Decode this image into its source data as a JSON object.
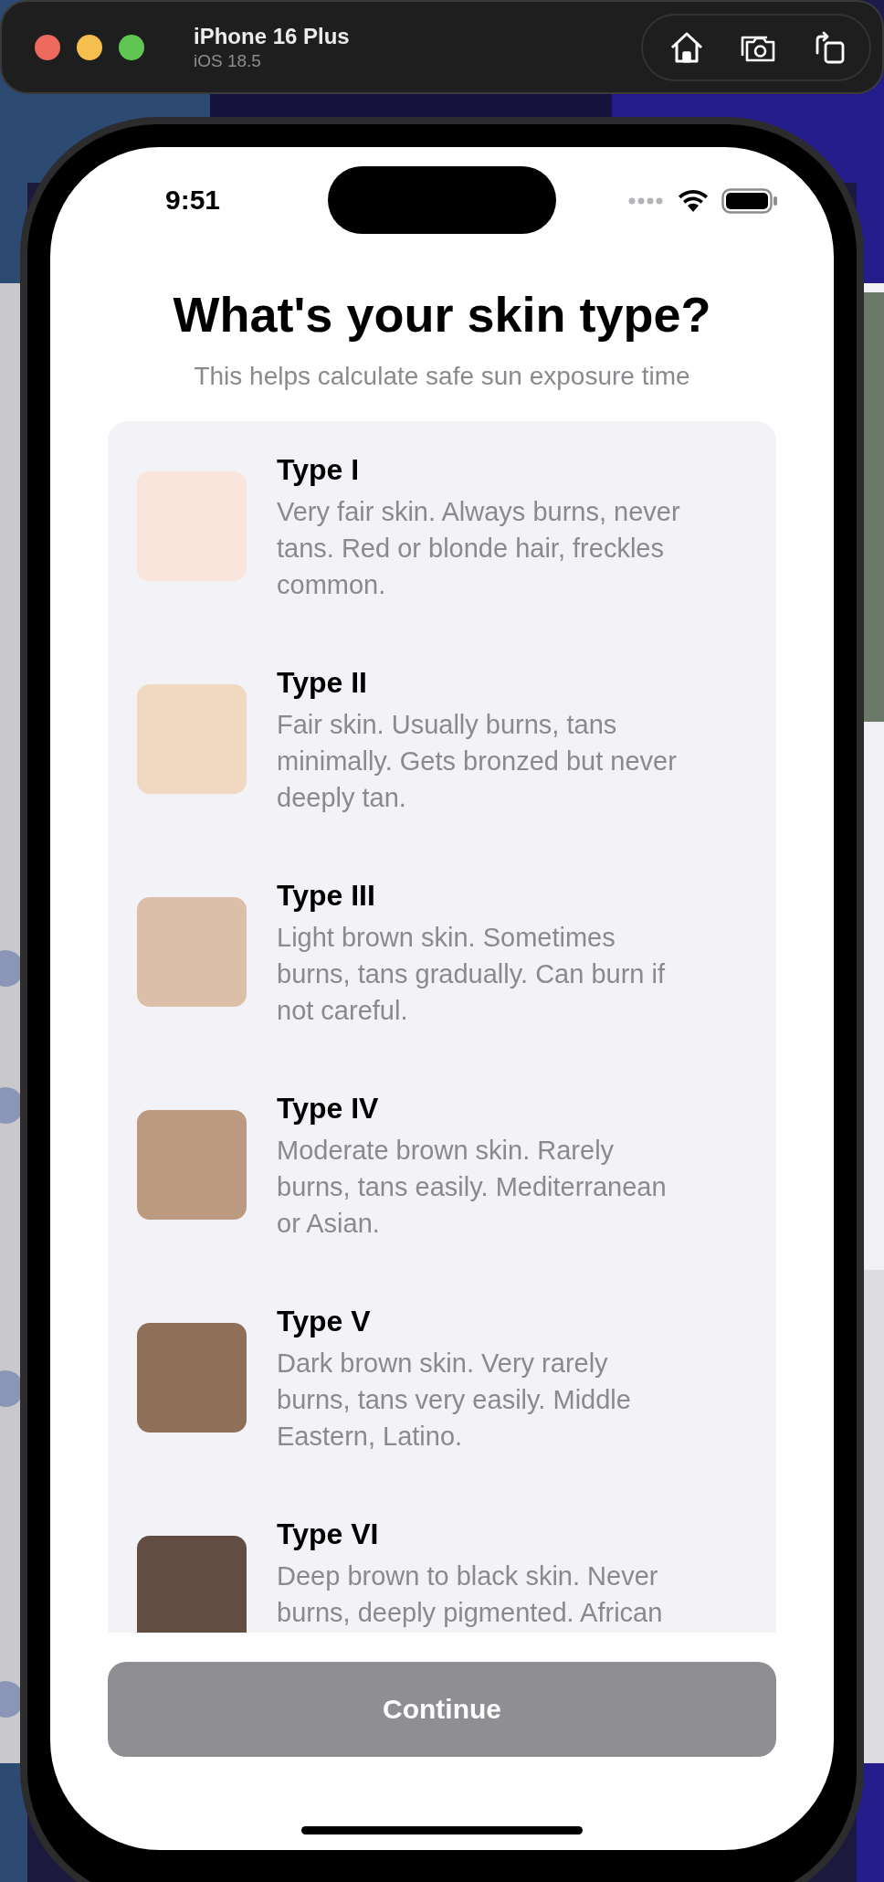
{
  "simulator": {
    "device": "iPhone 16 Plus",
    "os": "iOS 18.5"
  },
  "status_bar": {
    "time": "9:51"
  },
  "title": "What's your skin type?",
  "subtitle": "This helps calculate safe sun exposure time",
  "skin_types": [
    {
      "name": "Type I",
      "color": "#fae5dc",
      "description": [
        "Very fair skin. Always burns, never",
        "tans. Red or blonde hair, freckles",
        "common."
      ]
    },
    {
      "name": "Type II",
      "color": "#f0d9c0",
      "description": [
        "Fair skin. Usually burns, tans",
        "minimally. Gets bronzed but never",
        "deeply tan."
      ]
    },
    {
      "name": "Type III",
      "color": "#dbbfa8",
      "description": [
        "Light brown skin. Sometimes",
        "burns, tans gradually. Can burn if",
        "not careful."
      ]
    },
    {
      "name": "Type IV",
      "color": "#bb9a80",
      "description": [
        "Moderate brown skin. Rarely",
        "burns, tans easily. Mediterranean",
        "or Asian."
      ]
    },
    {
      "name": "Type V",
      "color": "#8e6f58",
      "description": [
        "Dark brown skin. Very rarely",
        "burns, tans very easily. Middle",
        "Eastern, Latino."
      ]
    },
    {
      "name": "Type VI",
      "color": "#614d42",
      "description": [
        "Deep brown to black skin. Never",
        "burns, deeply pigmented. African"
      ]
    }
  ],
  "continue_button": {
    "label": "Continue",
    "disabled": true
  }
}
